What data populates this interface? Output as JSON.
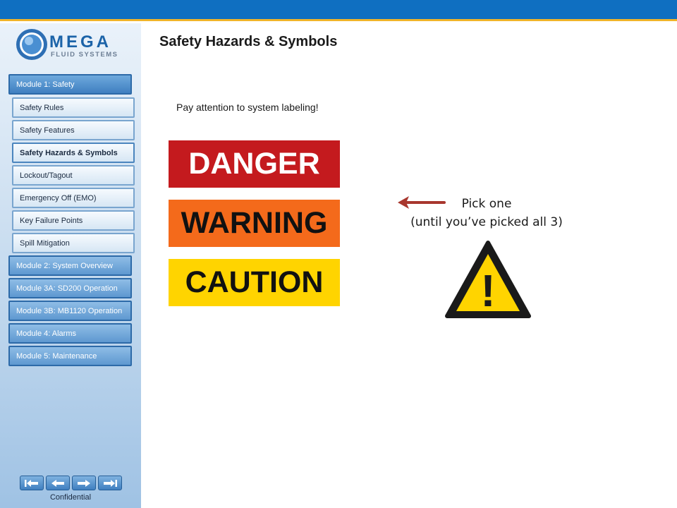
{
  "header": {
    "colors": {
      "bar": "#0f6fc1",
      "stripe": "#f0b42a"
    }
  },
  "logo": {
    "name": "MEGA",
    "subtitle": "FLUID SYSTEMS"
  },
  "page": {
    "title": "Safety Hazards & Symbols",
    "instruction": "Pay attention to system labeling!"
  },
  "sidebar": {
    "module1": "Module 1: Safety",
    "subitems": [
      {
        "label": "Safety Rules"
      },
      {
        "label": "Safety Features"
      },
      {
        "label": "Safety Hazards & Symbols",
        "active": true
      },
      {
        "label": "Lockout/Tagout"
      },
      {
        "label": "Emergency Off (EMO)"
      },
      {
        "label": "Key Failure Points"
      },
      {
        "label": "Spill Mitigation"
      }
    ],
    "modules": [
      {
        "label": "Module 2: System Overview"
      },
      {
        "label": "Module 3A: SD200 Operation"
      },
      {
        "label": "Module 3B: MB1120 Operation"
      },
      {
        "label": "Module 4: Alarms"
      },
      {
        "label": "Module 5: Maintenance"
      }
    ],
    "controls": [
      "first-icon",
      "back-icon",
      "next-icon",
      "last-icon"
    ],
    "footer": "Confidential"
  },
  "signs": {
    "danger": {
      "label": "DANGER",
      "color": "#c41a1e"
    },
    "warning": {
      "label": "WARNING",
      "color": "#f46a1b"
    },
    "caution": {
      "label": "CAUTION",
      "color": "#ffd400"
    }
  },
  "hint": {
    "line1": "Pick one",
    "line2": "(until you’ve picked all 3)",
    "arrow_color": "#a8372e"
  },
  "hazard_symbol": {
    "icon": "warning-triangle-icon",
    "glyph": "!",
    "fill": "#ffd400"
  }
}
